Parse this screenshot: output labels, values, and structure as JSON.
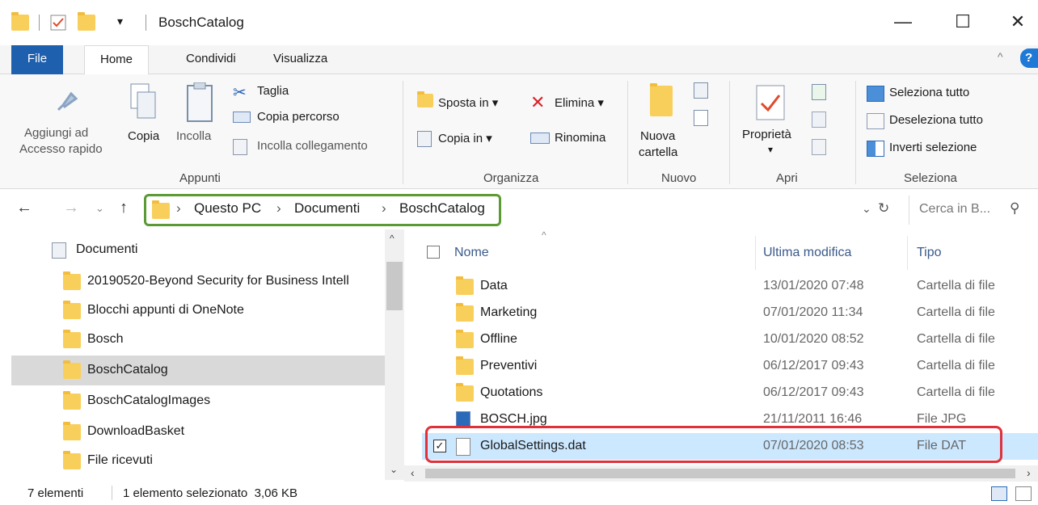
{
  "window": {
    "title": "BoschCatalog",
    "minimize_glyph": "—",
    "maximize_glyph": "☐",
    "close_glyph": "✕"
  },
  "ribbon_tabs": {
    "file": "File",
    "home": "Home",
    "share": "Condividi",
    "view": "Visualizza"
  },
  "ribbon": {
    "pin_line1": "Aggiungi ad",
    "pin_line2": "Accesso rapido",
    "copy": "Copia",
    "paste": "Incolla",
    "cut": "Taglia",
    "copy_path": "Copia percorso",
    "paste_shortcut": "Incolla collegamento",
    "group_clipboard": "Appunti",
    "move_to": "Sposta in ▾",
    "copy_to": "Copia in ▾",
    "delete": "Elimina ▾",
    "rename": "Rinomina",
    "group_organize": "Organizza",
    "new_folder_line1": "Nuova",
    "new_folder_line2": "cartella",
    "group_new": "Nuovo",
    "properties": "Proprietà",
    "properties_arrow": "▾",
    "group_open": "Apri",
    "select_all": "Seleziona tutto",
    "select_none": "Deseleziona tutto",
    "invert_selection": "Inverti selezione",
    "group_select": "Seleziona"
  },
  "address": {
    "crumbs": [
      "Questo PC",
      "Documenti",
      "BoschCatalog"
    ],
    "search_placeholder": "Cerca in B..."
  },
  "nav_pane": {
    "root": "Documenti",
    "items": [
      "20190520-Beyond Security for Business Intell",
      "Blocchi appunti di OneNote",
      "Bosch",
      "BoschCatalog",
      "BoschCatalogImages",
      "DownloadBasket",
      "File ricevuti"
    ],
    "selected_index": 3
  },
  "file_list": {
    "columns": {
      "name": "Nome",
      "modified": "Ultima modifica",
      "type": "Tipo"
    },
    "rows": [
      {
        "name": "Data",
        "modified": "13/01/2020 07:48",
        "type": "Cartella di file",
        "icon": "folder-icon"
      },
      {
        "name": "Marketing",
        "modified": "07/01/2020 11:34",
        "type": "Cartella di file",
        "icon": "folder-icon"
      },
      {
        "name": "Offline",
        "modified": "10/01/2020 08:52",
        "type": "Cartella di file",
        "icon": "folder-icon"
      },
      {
        "name": "Preventivi",
        "modified": "06/12/2017 09:43",
        "type": "Cartella di file",
        "icon": "folder-icon"
      },
      {
        "name": "Quotations",
        "modified": "06/12/2017 09:43",
        "type": "Cartella di file",
        "icon": "folder-icon"
      },
      {
        "name": "BOSCH.jpg",
        "modified": "21/11/2011 16:46",
        "type": "File JPG",
        "icon": "image-file-icon"
      },
      {
        "name": "GlobalSettings.dat",
        "modified": "07/01/2020 08:53",
        "type": "File DAT",
        "icon": "file-icon",
        "selected": true
      }
    ]
  },
  "status": {
    "count": "7 elementi",
    "selection": "1 elemento selezionato  3,06 KB"
  },
  "colors": {
    "file_tab": "#1e5fae",
    "folder": "#f9cf5c",
    "address_highlight": "#5b9a34",
    "selected_file_highlight": "#e0313b",
    "selected_row": "#cce8ff"
  }
}
